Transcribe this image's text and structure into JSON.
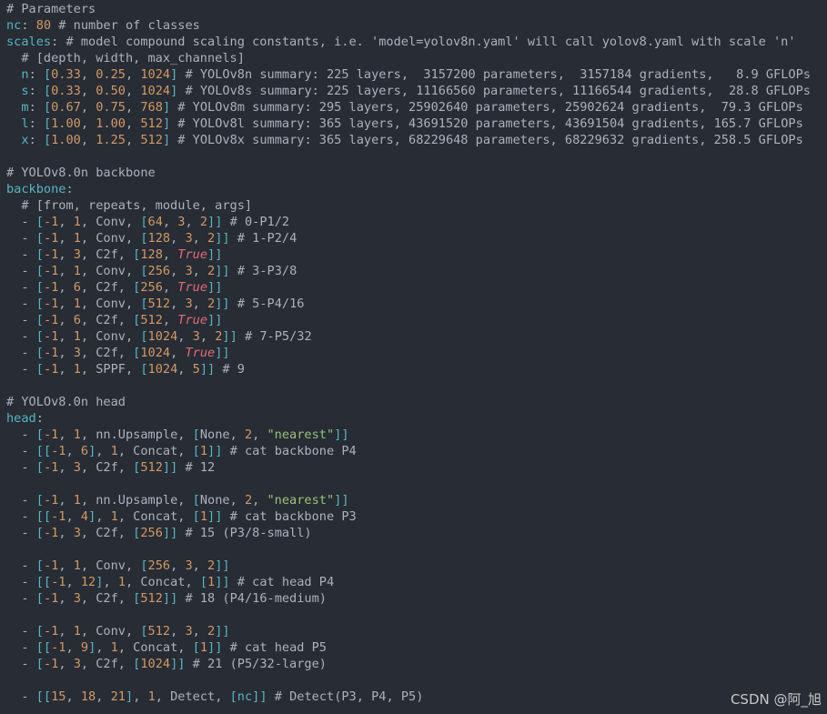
{
  "colors": {
    "background": "#282c34",
    "comment": "#abb2bf",
    "key": "#56b6c2",
    "number": "#d19a66",
    "bracket": "#56b6c2",
    "text": "#abb2bf",
    "bool": "#e06c75",
    "string": "#98c379"
  },
  "watermark": "CSDN @阿_旭",
  "lines": [
    [
      [
        "c",
        "# Parameters"
      ]
    ],
    [
      [
        "k",
        "nc"
      ],
      [
        "t",
        ": "
      ],
      [
        "n",
        "80"
      ],
      [
        "c",
        " # number of classes"
      ]
    ],
    [
      [
        "k",
        "scales"
      ],
      [
        "t",
        ":"
      ],
      [
        "c",
        " # model compound scaling constants, i.e. 'model=yolov8n.yaml' will call yolov8.yaml with scale 'n'"
      ]
    ],
    [
      [
        "c",
        "  # [depth, width, max_channels]"
      ]
    ],
    [
      [
        "k",
        "  n"
      ],
      [
        "t",
        ": "
      ],
      [
        "b",
        "["
      ],
      [
        "n",
        "0.33"
      ],
      [
        "t",
        ", "
      ],
      [
        "n",
        "0.25"
      ],
      [
        "t",
        ", "
      ],
      [
        "n",
        "1024"
      ],
      [
        "b",
        "]"
      ],
      [
        "c",
        " # YOLOv8n summary: 225 layers,  3157200 parameters,  3157184 gradients,   8.9 GFLOPs"
      ]
    ],
    [
      [
        "k",
        "  s"
      ],
      [
        "t",
        ": "
      ],
      [
        "b",
        "["
      ],
      [
        "n",
        "0.33"
      ],
      [
        "t",
        ", "
      ],
      [
        "n",
        "0.50"
      ],
      [
        "t",
        ", "
      ],
      [
        "n",
        "1024"
      ],
      [
        "b",
        "]"
      ],
      [
        "c",
        " # YOLOv8s summary: 225 layers, 11166560 parameters, 11166544 gradients,  28.8 GFLOPs"
      ]
    ],
    [
      [
        "k",
        "  m"
      ],
      [
        "t",
        ": "
      ],
      [
        "b",
        "["
      ],
      [
        "n",
        "0.67"
      ],
      [
        "t",
        ", "
      ],
      [
        "n",
        "0.75"
      ],
      [
        "t",
        ", "
      ],
      [
        "n",
        "768"
      ],
      [
        "b",
        "]"
      ],
      [
        "c",
        " # YOLOv8m summary: 295 layers, 25902640 parameters, 25902624 gradients,  79.3 GFLOPs"
      ]
    ],
    [
      [
        "k",
        "  l"
      ],
      [
        "t",
        ": "
      ],
      [
        "b",
        "["
      ],
      [
        "n",
        "1.00"
      ],
      [
        "t",
        ", "
      ],
      [
        "n",
        "1.00"
      ],
      [
        "t",
        ", "
      ],
      [
        "n",
        "512"
      ],
      [
        "b",
        "]"
      ],
      [
        "c",
        " # YOLOv8l summary: 365 layers, 43691520 parameters, 43691504 gradients, 165.7 GFLOPs"
      ]
    ],
    [
      [
        "k",
        "  x"
      ],
      [
        "t",
        ": "
      ],
      [
        "b",
        "["
      ],
      [
        "n",
        "1.00"
      ],
      [
        "t",
        ", "
      ],
      [
        "n",
        "1.25"
      ],
      [
        "t",
        ", "
      ],
      [
        "n",
        "512"
      ],
      [
        "b",
        "]"
      ],
      [
        "c",
        " # YOLOv8x summary: 365 layers, 68229648 parameters, 68229632 gradients, 258.5 GFLOPs"
      ]
    ],
    [],
    [
      [
        "c",
        "# YOLOv8.0n backbone"
      ]
    ],
    [
      [
        "k",
        "backbone"
      ],
      [
        "t",
        ":"
      ]
    ],
    [
      [
        "c",
        "  # [from, repeats, module, args]"
      ]
    ],
    [
      [
        "t",
        "  - "
      ],
      [
        "b",
        "["
      ],
      [
        "n",
        "-1"
      ],
      [
        "t",
        ", "
      ],
      [
        "n",
        "1"
      ],
      [
        "t",
        ", Conv, "
      ],
      [
        "b",
        "["
      ],
      [
        "n",
        "64"
      ],
      [
        "t",
        ", "
      ],
      [
        "n",
        "3"
      ],
      [
        "t",
        ", "
      ],
      [
        "n",
        "2"
      ],
      [
        "b",
        "]]"
      ],
      [
        "c",
        " # 0-P1/2"
      ]
    ],
    [
      [
        "t",
        "  - "
      ],
      [
        "b",
        "["
      ],
      [
        "n",
        "-1"
      ],
      [
        "t",
        ", "
      ],
      [
        "n",
        "1"
      ],
      [
        "t",
        ", Conv, "
      ],
      [
        "b",
        "["
      ],
      [
        "n",
        "128"
      ],
      [
        "t",
        ", "
      ],
      [
        "n",
        "3"
      ],
      [
        "t",
        ", "
      ],
      [
        "n",
        "2"
      ],
      [
        "b",
        "]]"
      ],
      [
        "c",
        " # 1-P2/4"
      ]
    ],
    [
      [
        "t",
        "  - "
      ],
      [
        "b",
        "["
      ],
      [
        "n",
        "-1"
      ],
      [
        "t",
        ", "
      ],
      [
        "n",
        "3"
      ],
      [
        "t",
        ", C2f, "
      ],
      [
        "b",
        "["
      ],
      [
        "n",
        "128"
      ],
      [
        "t",
        ", "
      ],
      [
        "i",
        "True"
      ],
      [
        "b",
        "]]"
      ]
    ],
    [
      [
        "t",
        "  - "
      ],
      [
        "b",
        "["
      ],
      [
        "n",
        "-1"
      ],
      [
        "t",
        ", "
      ],
      [
        "n",
        "1"
      ],
      [
        "t",
        ", Conv, "
      ],
      [
        "b",
        "["
      ],
      [
        "n",
        "256"
      ],
      [
        "t",
        ", "
      ],
      [
        "n",
        "3"
      ],
      [
        "t",
        ", "
      ],
      [
        "n",
        "2"
      ],
      [
        "b",
        "]]"
      ],
      [
        "c",
        " # 3-P3/8"
      ]
    ],
    [
      [
        "t",
        "  - "
      ],
      [
        "b",
        "["
      ],
      [
        "n",
        "-1"
      ],
      [
        "t",
        ", "
      ],
      [
        "n",
        "6"
      ],
      [
        "t",
        ", C2f, "
      ],
      [
        "b",
        "["
      ],
      [
        "n",
        "256"
      ],
      [
        "t",
        ", "
      ],
      [
        "i",
        "True"
      ],
      [
        "b",
        "]]"
      ]
    ],
    [
      [
        "t",
        "  - "
      ],
      [
        "b",
        "["
      ],
      [
        "n",
        "-1"
      ],
      [
        "t",
        ", "
      ],
      [
        "n",
        "1"
      ],
      [
        "t",
        ", Conv, "
      ],
      [
        "b",
        "["
      ],
      [
        "n",
        "512"
      ],
      [
        "t",
        ", "
      ],
      [
        "n",
        "3"
      ],
      [
        "t",
        ", "
      ],
      [
        "n",
        "2"
      ],
      [
        "b",
        "]]"
      ],
      [
        "c",
        " # 5-P4/16"
      ]
    ],
    [
      [
        "t",
        "  - "
      ],
      [
        "b",
        "["
      ],
      [
        "n",
        "-1"
      ],
      [
        "t",
        ", "
      ],
      [
        "n",
        "6"
      ],
      [
        "t",
        ", C2f, "
      ],
      [
        "b",
        "["
      ],
      [
        "n",
        "512"
      ],
      [
        "t",
        ", "
      ],
      [
        "i",
        "True"
      ],
      [
        "b",
        "]]"
      ]
    ],
    [
      [
        "t",
        "  - "
      ],
      [
        "b",
        "["
      ],
      [
        "n",
        "-1"
      ],
      [
        "t",
        ", "
      ],
      [
        "n",
        "1"
      ],
      [
        "t",
        ", Conv, "
      ],
      [
        "b",
        "["
      ],
      [
        "n",
        "1024"
      ],
      [
        "t",
        ", "
      ],
      [
        "n",
        "3"
      ],
      [
        "t",
        ", "
      ],
      [
        "n",
        "2"
      ],
      [
        "b",
        "]]"
      ],
      [
        "c",
        " # 7-P5/32"
      ]
    ],
    [
      [
        "t",
        "  - "
      ],
      [
        "b",
        "["
      ],
      [
        "n",
        "-1"
      ],
      [
        "t",
        ", "
      ],
      [
        "n",
        "3"
      ],
      [
        "t",
        ", C2f, "
      ],
      [
        "b",
        "["
      ],
      [
        "n",
        "1024"
      ],
      [
        "t",
        ", "
      ],
      [
        "i",
        "True"
      ],
      [
        "b",
        "]]"
      ]
    ],
    [
      [
        "t",
        "  - "
      ],
      [
        "b",
        "["
      ],
      [
        "n",
        "-1"
      ],
      [
        "t",
        ", "
      ],
      [
        "n",
        "1"
      ],
      [
        "t",
        ", SPPF, "
      ],
      [
        "b",
        "["
      ],
      [
        "n",
        "1024"
      ],
      [
        "t",
        ", "
      ],
      [
        "n",
        "5"
      ],
      [
        "b",
        "]]"
      ],
      [
        "c",
        " # 9"
      ]
    ],
    [],
    [
      [
        "c",
        "# YOLOv8.0n head"
      ]
    ],
    [
      [
        "k",
        "head"
      ],
      [
        "t",
        ":"
      ]
    ],
    [
      [
        "t",
        "  - "
      ],
      [
        "b",
        "["
      ],
      [
        "n",
        "-1"
      ],
      [
        "t",
        ", "
      ],
      [
        "n",
        "1"
      ],
      [
        "t",
        ", nn.Upsample, "
      ],
      [
        "b",
        "["
      ],
      [
        "t",
        "None, "
      ],
      [
        "n",
        "2"
      ],
      [
        "t",
        ", "
      ],
      [
        "s",
        "\"nearest\""
      ],
      [
        "b",
        "]]"
      ]
    ],
    [
      [
        "t",
        "  - "
      ],
      [
        "b",
        "[["
      ],
      [
        "n",
        "-1"
      ],
      [
        "t",
        ", "
      ],
      [
        "n",
        "6"
      ],
      [
        "b",
        "]"
      ],
      [
        "t",
        ", "
      ],
      [
        "n",
        "1"
      ],
      [
        "t",
        ", Concat, "
      ],
      [
        "b",
        "["
      ],
      [
        "n",
        "1"
      ],
      [
        "b",
        "]]"
      ],
      [
        "c",
        " # cat backbone P4"
      ]
    ],
    [
      [
        "t",
        "  - "
      ],
      [
        "b",
        "["
      ],
      [
        "n",
        "-1"
      ],
      [
        "t",
        ", "
      ],
      [
        "n",
        "3"
      ],
      [
        "t",
        ", C2f, "
      ],
      [
        "b",
        "["
      ],
      [
        "n",
        "512"
      ],
      [
        "b",
        "]]"
      ],
      [
        "c",
        " # 12"
      ]
    ],
    [],
    [
      [
        "t",
        "  - "
      ],
      [
        "b",
        "["
      ],
      [
        "n",
        "-1"
      ],
      [
        "t",
        ", "
      ],
      [
        "n",
        "1"
      ],
      [
        "t",
        ", nn.Upsample, "
      ],
      [
        "b",
        "["
      ],
      [
        "t",
        "None, "
      ],
      [
        "n",
        "2"
      ],
      [
        "t",
        ", "
      ],
      [
        "s",
        "\"nearest\""
      ],
      [
        "b",
        "]]"
      ]
    ],
    [
      [
        "t",
        "  - "
      ],
      [
        "b",
        "[["
      ],
      [
        "n",
        "-1"
      ],
      [
        "t",
        ", "
      ],
      [
        "n",
        "4"
      ],
      [
        "b",
        "]"
      ],
      [
        "t",
        ", "
      ],
      [
        "n",
        "1"
      ],
      [
        "t",
        ", Concat, "
      ],
      [
        "b",
        "["
      ],
      [
        "n",
        "1"
      ],
      [
        "b",
        "]]"
      ],
      [
        "c",
        " # cat backbone P3"
      ]
    ],
    [
      [
        "t",
        "  - "
      ],
      [
        "b",
        "["
      ],
      [
        "n",
        "-1"
      ],
      [
        "t",
        ", "
      ],
      [
        "n",
        "3"
      ],
      [
        "t",
        ", C2f, "
      ],
      [
        "b",
        "["
      ],
      [
        "n",
        "256"
      ],
      [
        "b",
        "]]"
      ],
      [
        "c",
        " # 15 (P3/8-small)"
      ]
    ],
    [],
    [
      [
        "t",
        "  - "
      ],
      [
        "b",
        "["
      ],
      [
        "n",
        "-1"
      ],
      [
        "t",
        ", "
      ],
      [
        "n",
        "1"
      ],
      [
        "t",
        ", Conv, "
      ],
      [
        "b",
        "["
      ],
      [
        "n",
        "256"
      ],
      [
        "t",
        ", "
      ],
      [
        "n",
        "3"
      ],
      [
        "t",
        ", "
      ],
      [
        "n",
        "2"
      ],
      [
        "b",
        "]]"
      ]
    ],
    [
      [
        "t",
        "  - "
      ],
      [
        "b",
        "[["
      ],
      [
        "n",
        "-1"
      ],
      [
        "t",
        ", "
      ],
      [
        "n",
        "12"
      ],
      [
        "b",
        "]"
      ],
      [
        "t",
        ", "
      ],
      [
        "n",
        "1"
      ],
      [
        "t",
        ", Concat, "
      ],
      [
        "b",
        "["
      ],
      [
        "n",
        "1"
      ],
      [
        "b",
        "]]"
      ],
      [
        "c",
        " # cat head P4"
      ]
    ],
    [
      [
        "t",
        "  - "
      ],
      [
        "b",
        "["
      ],
      [
        "n",
        "-1"
      ],
      [
        "t",
        ", "
      ],
      [
        "n",
        "3"
      ],
      [
        "t",
        ", C2f, "
      ],
      [
        "b",
        "["
      ],
      [
        "n",
        "512"
      ],
      [
        "b",
        "]]"
      ],
      [
        "c",
        " # 18 (P4/16-medium)"
      ]
    ],
    [],
    [
      [
        "t",
        "  - "
      ],
      [
        "b",
        "["
      ],
      [
        "n",
        "-1"
      ],
      [
        "t",
        ", "
      ],
      [
        "n",
        "1"
      ],
      [
        "t",
        ", Conv, "
      ],
      [
        "b",
        "["
      ],
      [
        "n",
        "512"
      ],
      [
        "t",
        ", "
      ],
      [
        "n",
        "3"
      ],
      [
        "t",
        ", "
      ],
      [
        "n",
        "2"
      ],
      [
        "b",
        "]]"
      ]
    ],
    [
      [
        "t",
        "  - "
      ],
      [
        "b",
        "[["
      ],
      [
        "n",
        "-1"
      ],
      [
        "t",
        ", "
      ],
      [
        "n",
        "9"
      ],
      [
        "b",
        "]"
      ],
      [
        "t",
        ", "
      ],
      [
        "n",
        "1"
      ],
      [
        "t",
        ", Concat, "
      ],
      [
        "b",
        "["
      ],
      [
        "n",
        "1"
      ],
      [
        "b",
        "]]"
      ],
      [
        "c",
        " # cat head P5"
      ]
    ],
    [
      [
        "t",
        "  - "
      ],
      [
        "b",
        "["
      ],
      [
        "n",
        "-1"
      ],
      [
        "t",
        ", "
      ],
      [
        "n",
        "3"
      ],
      [
        "t",
        ", C2f, "
      ],
      [
        "b",
        "["
      ],
      [
        "n",
        "1024"
      ],
      [
        "b",
        "]]"
      ],
      [
        "c",
        " # 21 (P5/32-large)"
      ]
    ],
    [],
    [
      [
        "t",
        "  - "
      ],
      [
        "b",
        "[["
      ],
      [
        "n",
        "15"
      ],
      [
        "t",
        ", "
      ],
      [
        "n",
        "18"
      ],
      [
        "t",
        ", "
      ],
      [
        "n",
        "21"
      ],
      [
        "b",
        "]"
      ],
      [
        "t",
        ", "
      ],
      [
        "n",
        "1"
      ],
      [
        "t",
        ", Detect, "
      ],
      [
        "b",
        "["
      ],
      [
        "k",
        "nc"
      ],
      [
        "b",
        "]]"
      ],
      [
        "c",
        " # Detect(P3, P4, P5)"
      ]
    ]
  ]
}
